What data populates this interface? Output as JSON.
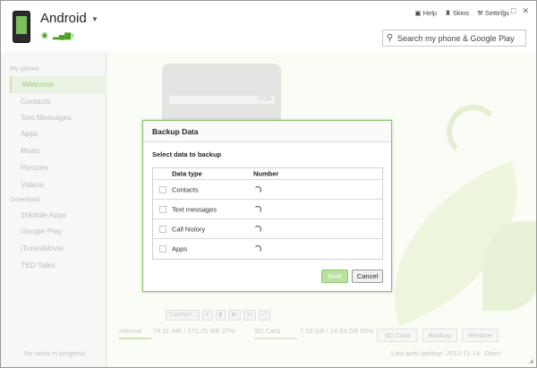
{
  "header": {
    "device_name": "Android",
    "help": "Help",
    "skins": "Skins",
    "settings": "Settings",
    "search_placeholder": "Search my phone & Google Play"
  },
  "sidebar": {
    "section_phone": "My phone",
    "items": [
      "Welcome",
      "Contacts",
      "Text Messages",
      "Apps",
      "Music",
      "Pictures",
      "Videos"
    ],
    "section_download": "Download",
    "download_items": [
      "1Mobile Apps",
      "Google Play",
      "iTunesMovie",
      "TED Talks"
    ],
    "footer": "No tasks in progress"
  },
  "main": {
    "phone_time": "23:24",
    "capture_label": "Capture",
    "internal_label": "Internal",
    "internal_usage": "74.31 MB / 271.25 MB 27%",
    "sd_label": "SD Card",
    "sd_usage": "7.53 GB / 14.83 GB 50%",
    "sd_card_button": "SD Card",
    "backup_button": "Backup",
    "restore_button": "Restore",
    "last_backup": "Last auto backup: 2012-11-14",
    "open_link": "Open"
  },
  "dialog": {
    "title": "Backup Data",
    "subtitle": "Select data to backup",
    "col_type": "Data type",
    "col_number": "Number",
    "rows": [
      "Contacts",
      "Text messages",
      "Call history",
      "Apps"
    ],
    "next": "Next",
    "cancel": "Cancel"
  },
  "colors": {
    "accent": "#8ac366",
    "brand_green": "#4aa321"
  }
}
